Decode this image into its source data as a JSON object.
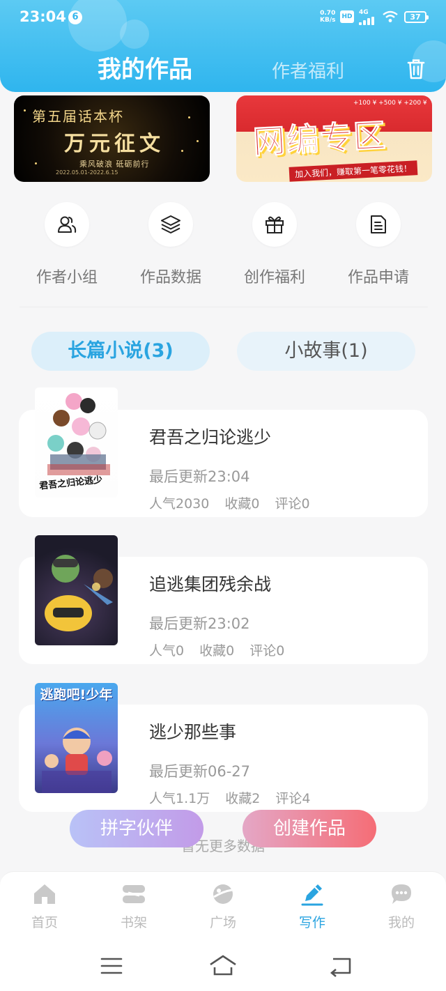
{
  "status_bar": {
    "time": "23:04",
    "notification_count": "6",
    "net_speed_value": "0.70",
    "net_speed_unit": "KB/s",
    "hd": "HD",
    "network": "4G",
    "battery": "37"
  },
  "header": {
    "tab_my_works": "我的作品",
    "tab_author_benefits": "作者福利"
  },
  "banners": {
    "left": {
      "line1": "第五届话本杯",
      "line2": "万元征文",
      "line3": "乘风破浪 砥砺前行",
      "line4": "2022.05.01-2022.6.15"
    },
    "right": {
      "title": "网编专区",
      "sub": "加入我们，赚取第一笔零花钱！",
      "points": "+100 ¥  +500 ¥  +200 ¥"
    }
  },
  "quick_menu": [
    {
      "label": "作者小组",
      "icon": "users-icon"
    },
    {
      "label": "作品数据",
      "icon": "layers-icon"
    },
    {
      "label": "创作福利",
      "icon": "gift-icon"
    },
    {
      "label": "作品申请",
      "icon": "document-icon"
    }
  ],
  "categories": {
    "long": "长篇小说(3)",
    "short": "小故事(1)"
  },
  "works": [
    {
      "title": "君吾之归论逃少",
      "updated": "最后更新23:04",
      "popularity": "人气2030",
      "favorites": "收藏0",
      "comments": "评论0",
      "cover_text": "君吾之归论逃少"
    },
    {
      "title": "追逃集团残余战",
      "updated": "最后更新23:02",
      "popularity": "人气0",
      "favorites": "收藏0",
      "comments": "评论0",
      "cover_text": ""
    },
    {
      "title": "逃少那些事",
      "updated": "最后更新06-27",
      "popularity": "人气1.1万",
      "favorites": "收藏2",
      "comments": "评论4",
      "cover_text": "逃跑吧!少年"
    }
  ],
  "no_more": "暂无更多数据",
  "floating": {
    "pinzi": "拼字伙伴",
    "create": "创建作品"
  },
  "bottom_nav": [
    {
      "label": "首页",
      "icon": "home-icon"
    },
    {
      "label": "书架",
      "icon": "bookshelf-icon"
    },
    {
      "label": "广场",
      "icon": "planet-icon"
    },
    {
      "label": "写作",
      "icon": "pen-icon"
    },
    {
      "label": "我的",
      "icon": "chat-bubble-icon"
    }
  ],
  "colors": {
    "header_blue": "#34b7ee",
    "accent": "#2aa4e0",
    "create_button": "#f56d76"
  }
}
